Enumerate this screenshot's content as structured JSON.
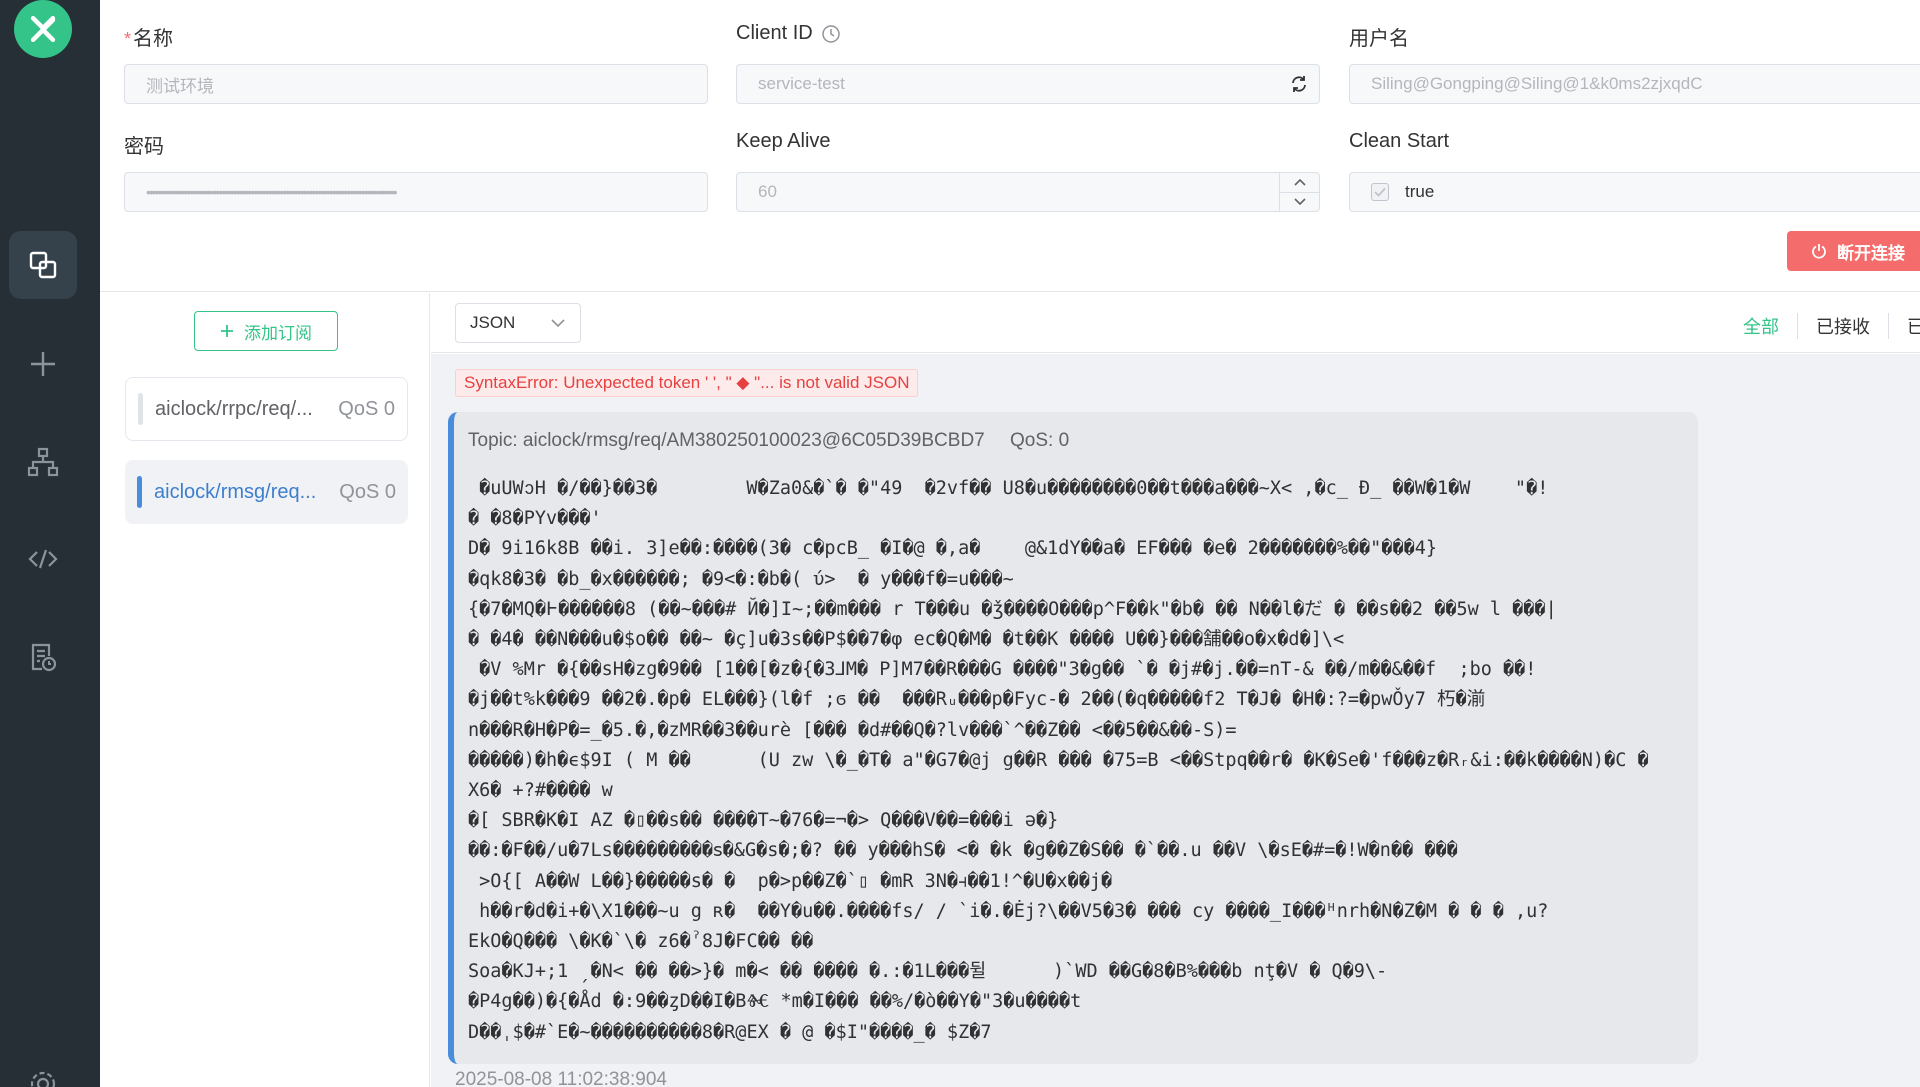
{
  "form": {
    "name": {
      "label": "名称",
      "placeholder": "测试环境"
    },
    "client_id": {
      "label": "Client ID",
      "value": "service-test"
    },
    "username": {
      "label": "用户名",
      "value": "Siling@Gongping@Siling@1&k0ms2zjxqdC"
    },
    "password": {
      "label": "密码",
      "value": "••••••••••••••••••••••••••••••••••••••••••••••••••••••••••••••••••••••••••••••••••••••"
    },
    "keep_alive": {
      "label": "Keep Alive",
      "value": "60"
    },
    "clean_start": {
      "label": "Clean Start",
      "value": "true"
    },
    "disconnect_label": "断开连接"
  },
  "subscriptions": {
    "add_label": "添加订阅",
    "items": [
      {
        "topic": "aiclock/rrpc/req/...",
        "qos": "QoS 0",
        "color": "#e0e3e8"
      },
      {
        "topic": "aiclock/rmsg/req...",
        "qos": "QoS 0",
        "color": "#4a8cdc"
      }
    ]
  },
  "messages": {
    "format": "JSON",
    "filters": [
      "全部",
      "已接收",
      "已发送"
    ],
    "error": "SyntaxError: Unexpected token ' ', \" ◆ \"... is not valid JSON",
    "card": {
      "topic": "Topic: aiclock/rmsg/req/AM380250100023@6C05D39BCBD7",
      "qos": "QoS: 0",
      "payload": " �uUWↄH �/��}��3�        W�Za0&�`� �\"49  �2vf�� U8�u��������0��t���a���~X< ,�c_ Đ_ ��W�1�W    \"�!\n� �8�PYv���'\nD� 9i16k8B ��i. 3]e��:����(3� c�pcB_ �I�@ �,a�    @&1dY��a� EF��� �e� 2�������%��\"���4}\n�qk8�3� �b_�x������; �9<�:�b�( ύ>  � y���f�=u���~\n{�7�MQ�Ͱ������8 (��~���# Й�]I~;��m��� r T���u �ǯ����O���p^F��k\"�b� �� N��l�だ � ��s��2 ��5w l ���|\n� �4� ��N���u�$o�� ��~ �ç]u�3s��P$��7�φ ec�Q�M� �t��K ���� U��}���舗��o�x�d�]\\<\n �V %Mr �{��sH�zg�9�� [1��[�z�{�3⅃M� P]M7��R���G ����\"3�g�� `� �j#�j.��=nT-& ��/m��&��f  ;bo ��!\n�j��t%k���9 ��2�.�p� EL���}(l�f ;ϭ ��  ���Rᵤ���p�Fyc-� 2��(�q�����f2 T�J� �H�:?=�pwǑy7 朽�湔\nn���R�H�P�=_�5.�,�zMR��3��urѐ [��� �d#��Q�?lv���`^��Z�� <��5��&��-S)=\n�����)�h�ϵ$9I ( M ��      (U zw \\�_�T� a\"�G7�@j g��R ��� �75=B <��Stpq��r� �K�Se�'f���z�Rᵣ&i:��k����N)�C �\nX6� +?#���� w\n�[ SBR�K�I AZ �▯��s�� ����T~�76�=¬�> Q���V��=���i ə�}\n��:�F��/u�7Ls���������ꜱ�&G�s�;�? �� y���hS� <� �k �g��Z�S�� �`��.u ��V \\�sE�#=�!W�n�� ���\n >O{[ A��W L��}�����s� �  p�>p��Z�`▯ �mR 3N�⫞��1!^�U�x��j�\n h��r�d�i+�\\X1���~u g ʀ�  ��Y�u��.����fs/ / `i�.�Ėj?\\��V5�3� ��� cy ����_I���ᵸnrh�N�Z�M � � � ,u?\nEkO�Q��� \\�K�`\\� z6�ˀ8J�FC�� ��\nSoa�KJ+;1 ˏ�N< �� ��>}� m�< �� ���� �.:�1L���뒬      )`WD ��G�8�B%���b nţ�V � Q�9\\-\n�P4g��)�{�Åd �:9��ȥD��I�BⰩ *m�I��� ��%/�ò��Y�\"3�u����t\nD��ˌ$�#`E�~����������8�R@EX � @ �$I\"����_� $Z�7"
    },
    "timestamp": "2025-08-08 11:02:38:904"
  },
  "colors": {
    "accent": "#34c388",
    "danger": "#f56c6c",
    "sidebar": "#262f36",
    "message_bar": "#4a8cdc"
  }
}
